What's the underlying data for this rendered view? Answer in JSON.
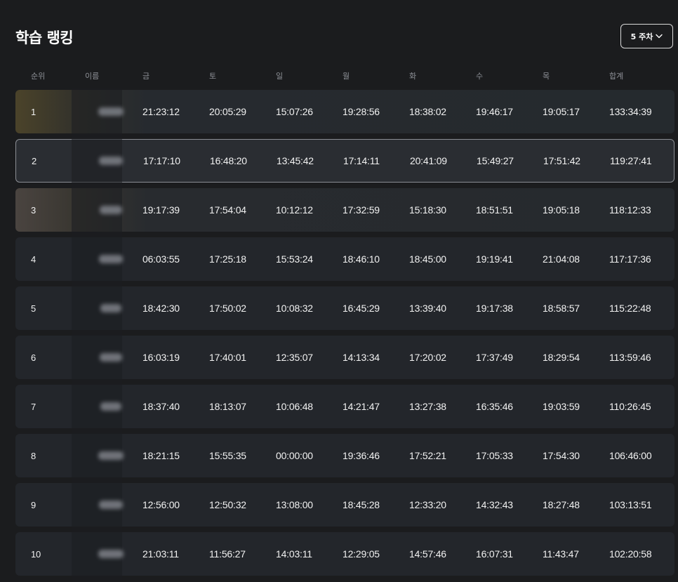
{
  "title": "학습 랭킹",
  "week_selector": {
    "label": "5 주차",
    "icon": "chevron-down-icon"
  },
  "columns": [
    "순위",
    "이름",
    "금",
    "토",
    "일",
    "월",
    "화",
    "수",
    "목",
    "합계"
  ],
  "rows": [
    {
      "rank": "1",
      "times": [
        "21:23:12",
        "20:05:29",
        "15:07:26",
        "19:28:56",
        "18:38:02",
        "19:46:17",
        "19:05:17"
      ],
      "total": "133:34:39"
    },
    {
      "rank": "2",
      "times": [
        "17:17:10",
        "16:48:20",
        "13:45:42",
        "17:14:11",
        "20:41:09",
        "15:49:27",
        "17:51:42"
      ],
      "total": "119:27:41"
    },
    {
      "rank": "3",
      "times": [
        "19:17:39",
        "17:54:04",
        "10:12:12",
        "17:32:59",
        "15:18:30",
        "18:51:51",
        "19:05:18"
      ],
      "total": "118:12:33"
    },
    {
      "rank": "4",
      "times": [
        "06:03:55",
        "17:25:18",
        "15:53:24",
        "18:46:10",
        "18:45:00",
        "19:19:41",
        "21:04:08"
      ],
      "total": "117:17:36"
    },
    {
      "rank": "5",
      "times": [
        "18:42:30",
        "17:50:02",
        "10:08:32",
        "16:45:29",
        "13:39:40",
        "19:17:38",
        "18:58:57"
      ],
      "total": "115:22:48"
    },
    {
      "rank": "6",
      "times": [
        "16:03:19",
        "17:40:01",
        "12:35:07",
        "14:13:34",
        "17:20:02",
        "17:37:49",
        "18:29:54"
      ],
      "total": "113:59:46"
    },
    {
      "rank": "7",
      "times": [
        "18:37:40",
        "18:13:07",
        "10:06:48",
        "14:21:47",
        "13:27:38",
        "16:35:46",
        "19:03:59"
      ],
      "total": "110:26:45"
    },
    {
      "rank": "8",
      "times": [
        "18:21:15",
        "15:55:35",
        "00:00:00",
        "19:36:46",
        "17:52:21",
        "17:05:33",
        "17:54:30"
      ],
      "total": "106:46:00"
    },
    {
      "rank": "9",
      "times": [
        "12:56:00",
        "12:50:32",
        "13:08:00",
        "18:45:28",
        "12:33:20",
        "14:32:43",
        "18:27:48"
      ],
      "total": "103:13:51"
    },
    {
      "rank": "10",
      "times": [
        "21:03:11",
        "11:56:27",
        "14:03:11",
        "12:29:05",
        "14:57:46",
        "16:07:31",
        "11:43:47"
      ],
      "total": "102:20:58"
    }
  ]
}
